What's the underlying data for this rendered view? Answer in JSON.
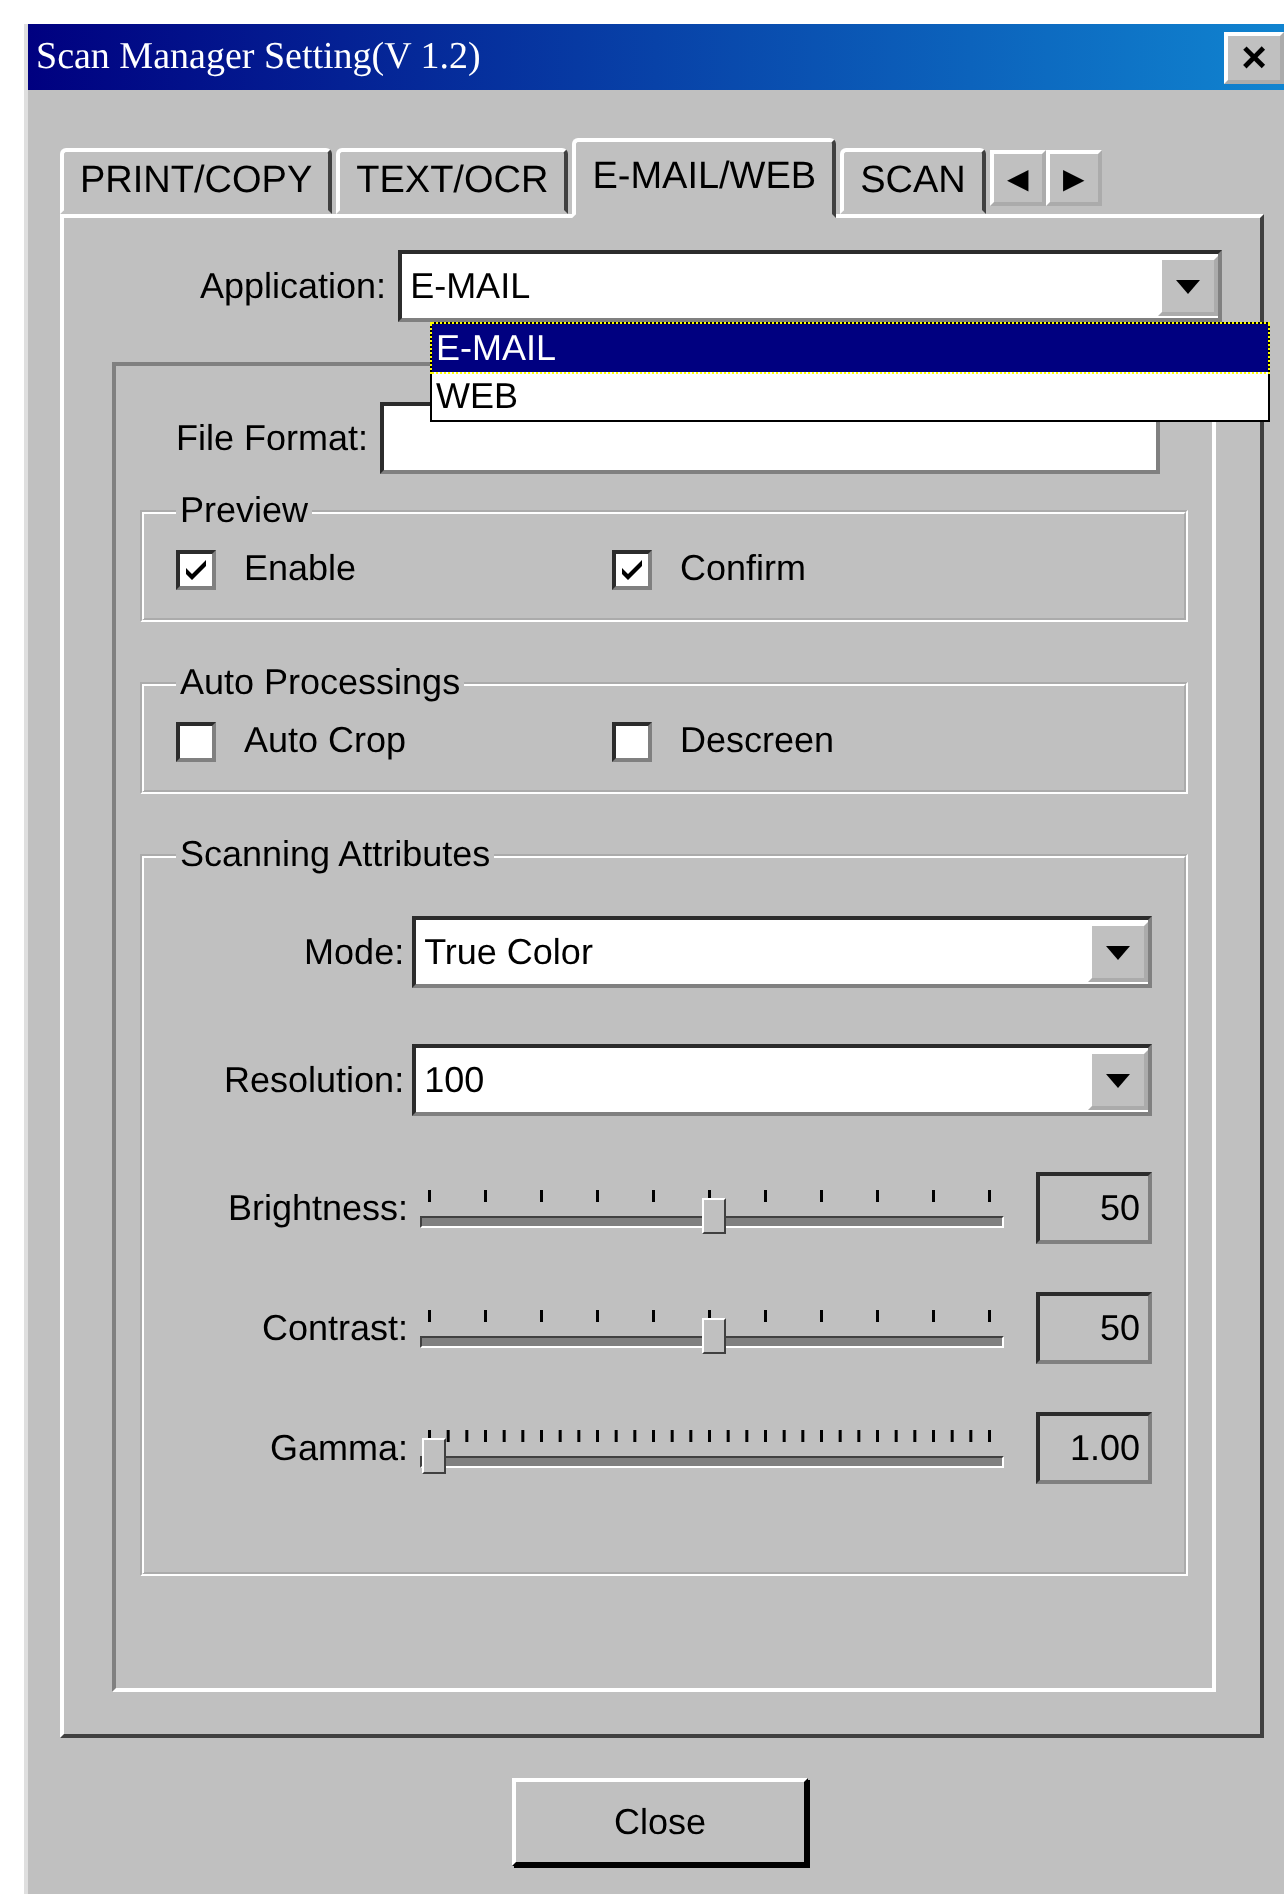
{
  "window": {
    "title": "Scan Manager Setting(V 1.2)",
    "close": "×"
  },
  "tabs": [
    {
      "label": "PRINT/COPY",
      "selected": false
    },
    {
      "label": "TEXT/OCR",
      "selected": false
    },
    {
      "label": "E-MAIL/WEB",
      "selected": true
    },
    {
      "label": "SCAN",
      "selected": false
    }
  ],
  "tab_scroll": [
    "◀",
    "▶"
  ],
  "application": {
    "label": "Application:",
    "value": "E-MAIL",
    "expanded": true,
    "options": [
      {
        "label": "E-MAIL",
        "selected": true
      },
      {
        "label": "WEB",
        "selected": false
      }
    ]
  },
  "file_format": {
    "label": "File Format:"
  },
  "preview": {
    "title": "Preview",
    "options": [
      {
        "label": "Enable",
        "checked": true
      },
      {
        "label": "Confirm",
        "checked": true
      }
    ]
  },
  "auto_processings": {
    "title": "Auto Processings",
    "options": [
      {
        "label": "Auto Crop",
        "checked": false
      },
      {
        "label": "Descreen",
        "checked": false
      }
    ]
  },
  "scanning_attributes": {
    "title": "Scanning Attributes",
    "dropdowns": [
      {
        "label": "Mode:",
        "value": "True Color"
      },
      {
        "label": "Resolution:",
        "value": "100"
      }
    ],
    "sliders": [
      {
        "label": "Brightness:",
        "kind": "coarse",
        "level": 0.5,
        "reading": "50"
      },
      {
        "label": "Contrast:",
        "kind": "coarse",
        "level": 0.5,
        "reading": "50"
      },
      {
        "label": "Gamma:",
        "kind": "fine",
        "level": 0,
        "reading": "1.00"
      }
    ]
  },
  "buttons": [
    "Close"
  ]
}
